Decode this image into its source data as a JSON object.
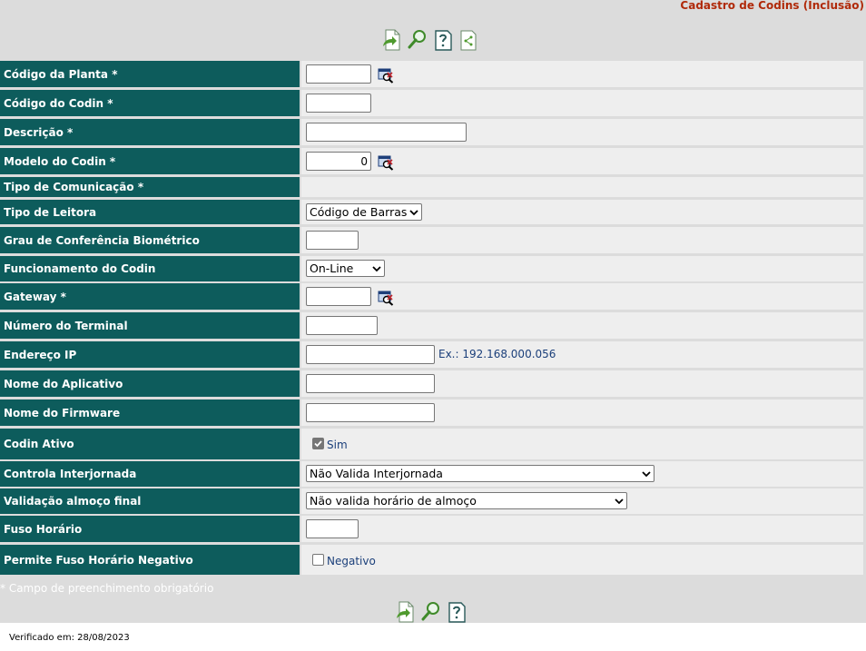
{
  "header": {
    "title": "Cadastro de Codins (Inclusão)"
  },
  "toolbar_top": [
    {
      "icon": "save-icon"
    },
    {
      "icon": "search-icon"
    },
    {
      "icon": "help-icon"
    },
    {
      "icon": "export-icon"
    }
  ],
  "toolbar_bottom": [
    {
      "icon": "save-icon"
    },
    {
      "icon": "search-icon"
    },
    {
      "icon": "help-icon"
    }
  ],
  "form": {
    "codigo_planta": {
      "label": "Código da Planta *",
      "value": ""
    },
    "codigo_codin": {
      "label": "Código do Codin *",
      "value": ""
    },
    "descricao": {
      "label": "Descrição *",
      "value": ""
    },
    "modelo_codin": {
      "label": "Modelo do Codin *",
      "value": "0"
    },
    "tipo_comunicacao": {
      "label": "Tipo de Comunicação *"
    },
    "tipo_leitora": {
      "label": "Tipo de Leitora",
      "selected": "Código de Barras"
    },
    "grau_conferencia": {
      "label": "Grau de Conferência Biométrico",
      "value": ""
    },
    "funcionamento": {
      "label": "Funcionamento do Codin",
      "selected": "On-Line"
    },
    "gateway": {
      "label": "Gateway *",
      "value": ""
    },
    "numero_terminal": {
      "label": "Número do Terminal",
      "value": ""
    },
    "endereco_ip": {
      "label": "Endereço IP",
      "value": "",
      "hint": "Ex.: 192.168.000.056"
    },
    "nome_aplicativo": {
      "label": "Nome do Aplicativo",
      "value": ""
    },
    "nome_firmware": {
      "label": "Nome do Firmware",
      "value": ""
    },
    "codin_ativo": {
      "label": "Codin Ativo",
      "checked": true,
      "checkbox_label": "Sim"
    },
    "controla_interjornada": {
      "label": "Controla Interjornada",
      "selected": "Não Valida Interjornada"
    },
    "validacao_almoco": {
      "label": "Validação almoço final",
      "selected": "Não valida horário de almoço"
    },
    "fuso_horario": {
      "label": "Fuso Horário",
      "value": ""
    },
    "fuso_negativo": {
      "label": "Permite Fuso Horário Negativo",
      "checked": false,
      "checkbox_label": "Negativo"
    }
  },
  "footnote": "* Campo de preenchimento obrigatório",
  "verified": "Verificado em: 28/08/2023",
  "colors": {
    "label_bg": "#0d5c5c",
    "value_bg": "#eeeeee",
    "page_bg": "#dcdcdc",
    "title": "#b02a0a",
    "hint": "#1b3f7a"
  }
}
